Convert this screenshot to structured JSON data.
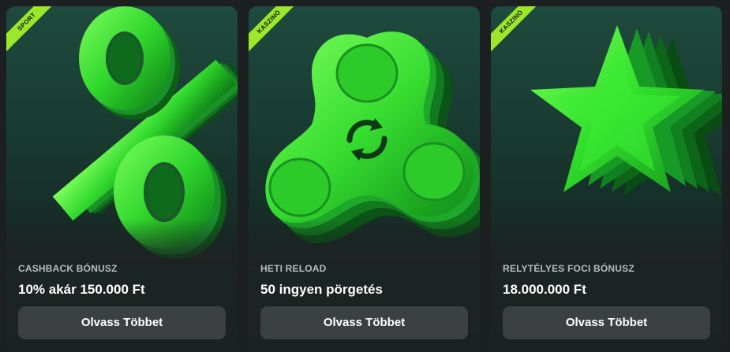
{
  "cards": [
    {
      "ribbon": "SPORT",
      "category": "CASHBACK BÓNUSZ",
      "headline": "10% akár 150.000 Ft",
      "button_label": "Olvass Többet",
      "art_icon": "percent-symbol"
    },
    {
      "ribbon": "KASZINÓ",
      "category": "HETI RELOAD",
      "headline": "50 ingyen pörgetés",
      "button_label": "Olvass Többet",
      "art_icon": "fidget-spinner"
    },
    {
      "ribbon": "KASZINÓ",
      "category": "RELYTÉLYES FOCI BÓNUSZ",
      "headline": "18.000.000 Ft",
      "button_label": "Olvass Többet",
      "art_icon": "star"
    }
  ],
  "colors": {
    "accent_green": "#9de72a",
    "art_green": "#3fe83a",
    "button_bg": "#3c4040",
    "page_bg": "#1d2020"
  }
}
